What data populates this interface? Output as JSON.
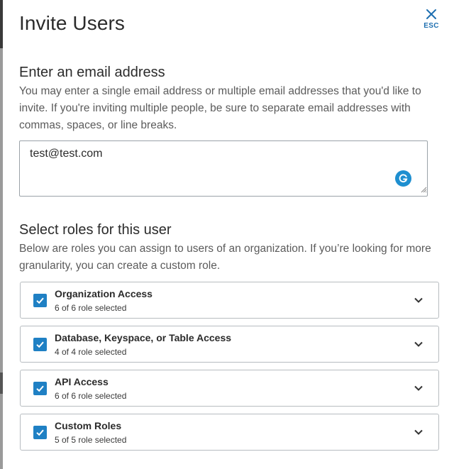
{
  "dialog": {
    "title": "Invite Users",
    "close_label": "ESC"
  },
  "email_section": {
    "heading": "Enter an email address",
    "description": "You may enter a single email address or multiple email addresses that you'd like to invite. If you're inviting multiple people, be sure to separate email addresses with commas, spaces, or line breaks.",
    "value": "test@test.com"
  },
  "roles_section": {
    "heading": "Select roles for this user",
    "description": "Below are roles you can assign to users of an organization. If you’re looking for more granularity, you can create a custom role.",
    "roles": [
      {
        "name": "Organization Access",
        "summary": "6 of 6 role selected",
        "checked": true
      },
      {
        "name": "Database, Keyspace, or Table Access",
        "summary": "4 of 4 role selected",
        "checked": true
      },
      {
        "name": "API Access",
        "summary": "6 of 6 role selected",
        "checked": true
      },
      {
        "name": "Custom Roles",
        "summary": "5 of 5 role selected",
        "checked": true
      }
    ]
  },
  "colors": {
    "accent": "#1f80c4",
    "close": "#1e6fb0",
    "grammarly": "#1e8fd0"
  },
  "icons": {
    "close": "close-icon",
    "checkbox": "check-icon",
    "expand": "chevron-down-icon",
    "grammarly": "grammarly-icon"
  }
}
